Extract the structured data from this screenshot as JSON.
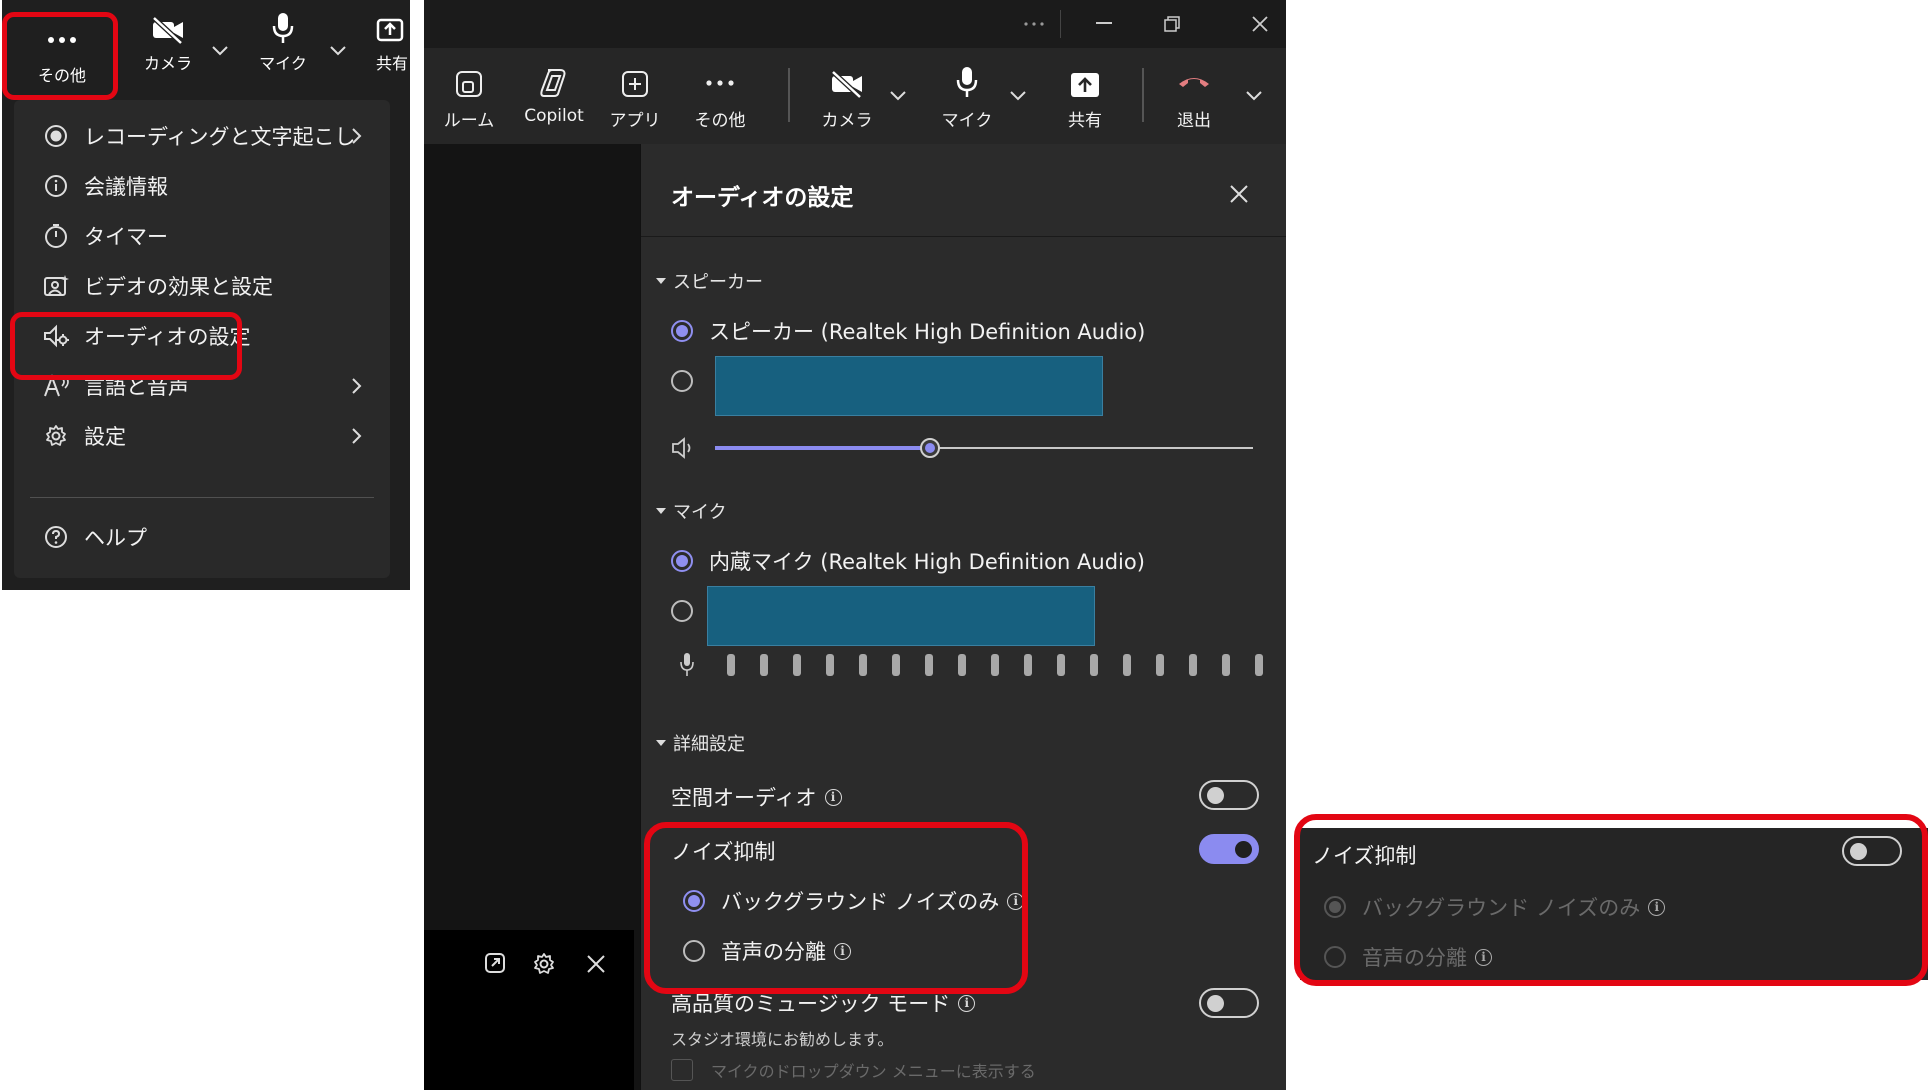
{
  "menu_panel": {
    "toolbar": {
      "more": "その他",
      "camera": "カメラ",
      "mic": "マイク",
      "share": "共有"
    },
    "items": [
      {
        "label": "レコーディングと文字起こし",
        "icon": "record-icon",
        "submenu": true
      },
      {
        "label": "会議情報",
        "icon": "info-icon",
        "submenu": false
      },
      {
        "label": "タイマー",
        "icon": "timer-icon",
        "submenu": false
      },
      {
        "label": "ビデオの効果と設定",
        "icon": "video-effects-icon",
        "submenu": false
      },
      {
        "label": "オーディオの設定",
        "icon": "audio-settings-icon",
        "submenu": false,
        "highlighted": true
      },
      {
        "label": "言語と音声",
        "icon": "language-icon",
        "submenu": true
      },
      {
        "label": "設定",
        "icon": "gear-icon",
        "submenu": true
      },
      {
        "label": "ヘルプ",
        "icon": "help-icon",
        "submenu": false
      }
    ]
  },
  "meeting": {
    "toolbar": {
      "room": "ルーム",
      "copilot": "Copilot",
      "apps": "アプリ",
      "more": "その他",
      "camera": "カメラ",
      "mic": "マイク",
      "share": "共有",
      "leave": "退出"
    },
    "audio_settings": {
      "title": "オーディオの設定",
      "speaker_section": "スピーカー",
      "speaker_option": "スピーカー (Realtek High Definition Audio)",
      "speaker_volume": 0.4,
      "mic_section": "マイク",
      "mic_option": "内蔵マイク (Realtek High Definition Audio)",
      "advanced_section": "詳細設定",
      "spatial_audio": "空間オーディオ",
      "spatial_audio_on": false,
      "noise_suppression": "ノイズ抑制",
      "noise_suppression_on": true,
      "background_noise_only": "バックグラウンド ノイズのみ",
      "voice_isolation": "音声の分離",
      "music_mode": "高品質のミュージック モード",
      "music_mode_on": false,
      "music_mode_desc": "スタジオ環境にお勧めします。",
      "show_in_mic_menu": "マイクのドロップダウン メニューに表示する"
    }
  },
  "noise_off_panel": {
    "noise_suppression": "ノイズ抑制",
    "noise_suppression_on": false,
    "background_noise_only": "バックグラウンド ノイズのみ",
    "voice_isolation": "音声の分離"
  },
  "colors": {
    "highlight": "#e30613",
    "accent": "#8b8bf0",
    "device_box": "#17607f",
    "panel_bg": "#2b2b2b",
    "leave_red": "#e37d80"
  }
}
